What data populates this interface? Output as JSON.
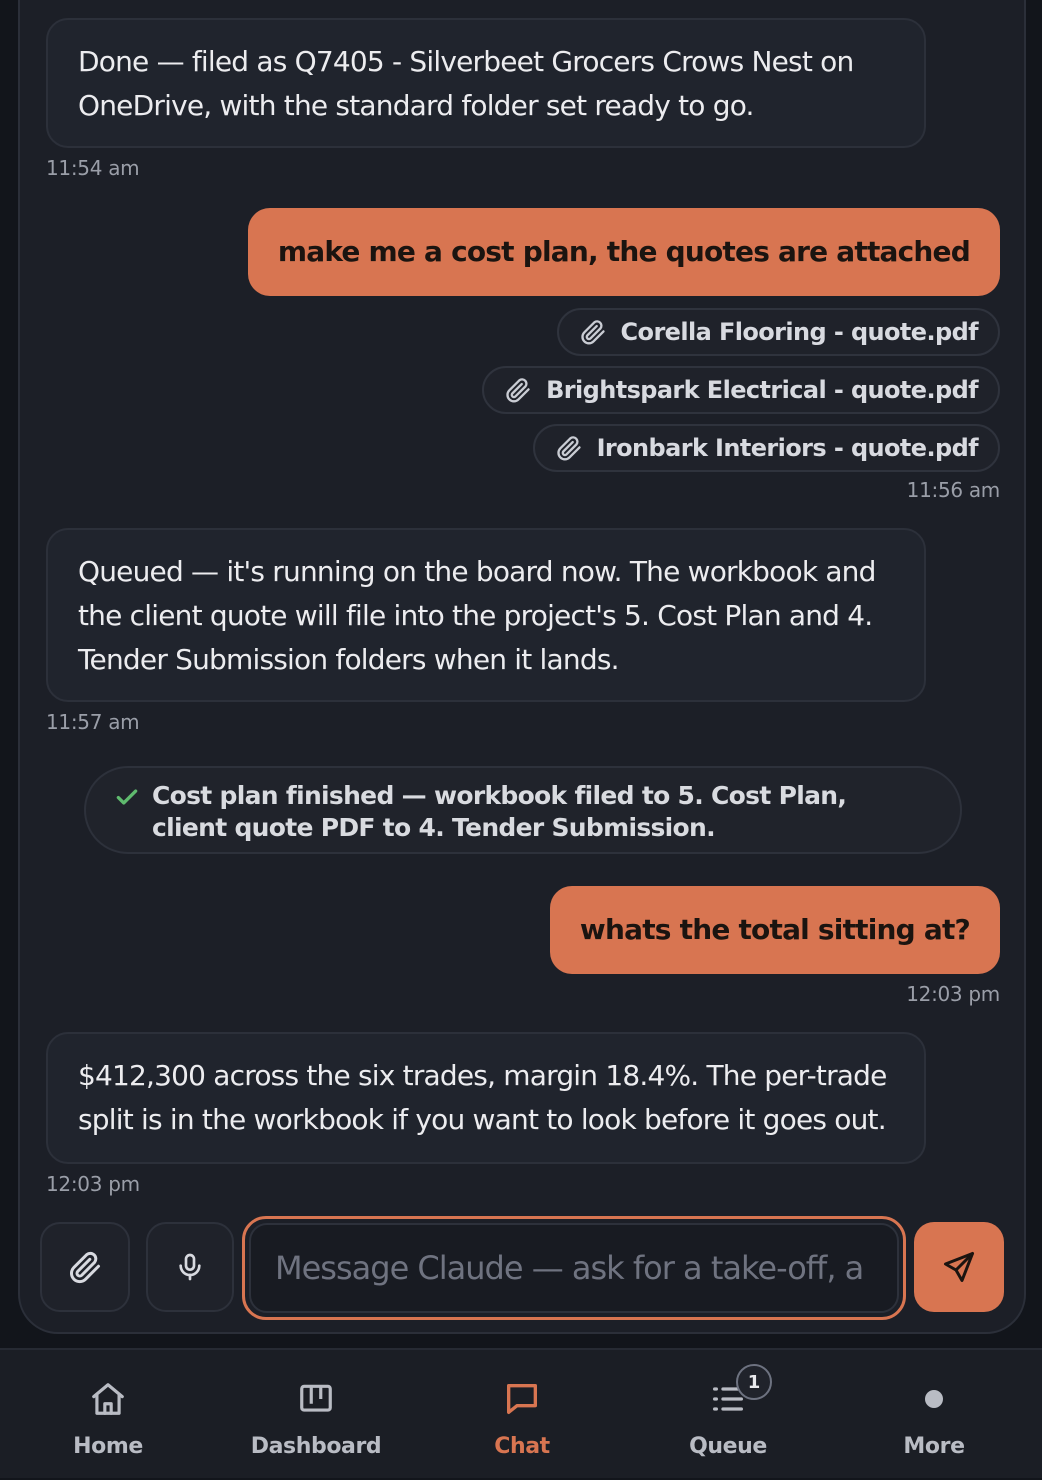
{
  "messages": [
    {
      "role": "assistant",
      "text": "Done — filed as Q7405 - Silverbeet Grocers Crows Nest on OneDrive, with the standard folder set ready to go.",
      "time": "11:54 am"
    },
    {
      "role": "user",
      "text": "make me a cost plan, the quotes are attached",
      "time": "11:56 am",
      "attachments": [
        "Corella Flooring - quote.pdf",
        "Brightspark Electrical - quote.pdf",
        "Ironbark Interiors - quote.pdf"
      ]
    },
    {
      "role": "assistant",
      "text": "Queued — it's running on the board now. The workbook and the client quote will file into the project's 5. Cost Plan and 4. Tender Submission folders when it lands.",
      "time": "11:57 am"
    },
    {
      "role": "status",
      "text": "Cost plan finished — workbook filed to 5. Cost Plan, client quote PDF to 4. Tender Submission."
    },
    {
      "role": "user",
      "text": "whats the total sitting at?",
      "time": "12:03 pm"
    },
    {
      "role": "assistant",
      "text": "$412,300 across the six trades, margin 18.4%. The per-trade split is in the workbook if you want to look before it goes out.",
      "time": "12:03 pm"
    }
  ],
  "composer": {
    "placeholder": "Message Claude — ask for a take-off, a cost plan…",
    "value": ""
  },
  "nav": {
    "items": [
      {
        "label": "Home",
        "icon": "home-icon"
      },
      {
        "label": "Dashboard",
        "icon": "kanban-icon"
      },
      {
        "label": "Chat",
        "icon": "chat-icon",
        "active": true
      },
      {
        "label": "Queue",
        "icon": "list-icon",
        "badge": "1"
      },
      {
        "label": "More",
        "icon": "dot-icon"
      }
    ]
  },
  "colors": {
    "accent": "#d87551",
    "background": "#12151b",
    "panel": "#1c1f27",
    "bubble": "#20242d",
    "success": "#5fba6e"
  }
}
